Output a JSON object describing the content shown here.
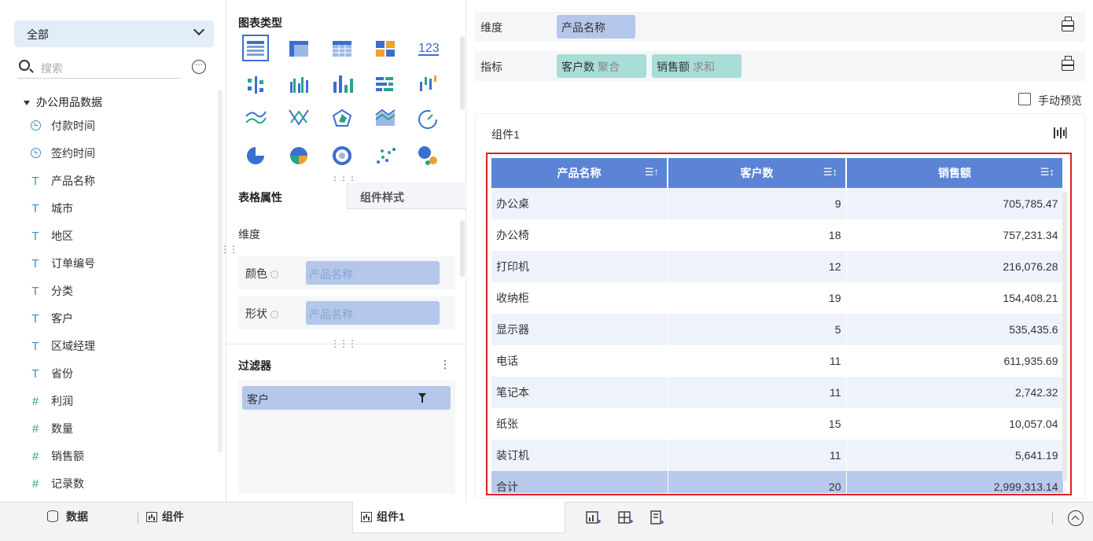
{
  "left": {
    "dropdown": "全部",
    "search_placeholder": "搜索",
    "more": "···",
    "dataset": "办公用品数据",
    "fields": [
      {
        "type": "date",
        "label": "付款时间"
      },
      {
        "type": "date",
        "label": "签约时间"
      },
      {
        "type": "text",
        "label": "产品名称"
      },
      {
        "type": "text",
        "label": "城市"
      },
      {
        "type": "text",
        "label": "地区"
      },
      {
        "type": "text",
        "label": "订单编号"
      },
      {
        "type": "text",
        "label": "分类"
      },
      {
        "type": "text",
        "label": "客户"
      },
      {
        "type": "text",
        "label": "区域经理"
      },
      {
        "type": "text",
        "label": "省份"
      },
      {
        "type": "number",
        "label": "利润"
      },
      {
        "type": "number",
        "label": "数量"
      },
      {
        "type": "number",
        "label": "销售额"
      },
      {
        "type": "number",
        "label": "记录数"
      }
    ]
  },
  "middle": {
    "chart_type_title": "图表类型",
    "tab_table_props": "表格属性",
    "tab_component_style": "组件样式",
    "dimension_label": "维度",
    "color_label": "颜色",
    "color_placeholder": "产品名称",
    "shape_label": "形状",
    "shape_placeholder": "产品名称",
    "filter_title": "过滤器",
    "filter_more": "⋮",
    "filter_item": "客户"
  },
  "right": {
    "dimension_label": "维度",
    "dimension_chip": "产品名称",
    "metric_label": "指标",
    "metric_chips": [
      {
        "name": "客户数",
        "agg": "聚合"
      },
      {
        "name": "销售额",
        "agg": "求和"
      }
    ],
    "manual_preview": "手动预览",
    "widget_title": "组件1",
    "table": {
      "headers": [
        "产品名称",
        "客户数",
        "销售额"
      ],
      "rows": [
        [
          "办公桌",
          "9",
          "705,785.47"
        ],
        [
          "办公椅",
          "18",
          "757,231.34"
        ],
        [
          "打印机",
          "12",
          "216,076.28"
        ],
        [
          "收纳柜",
          "19",
          "154,408.21"
        ],
        [
          "显示器",
          "5",
          "535,435.6"
        ],
        [
          "电话",
          "11",
          "611,935.69"
        ],
        [
          "笔记本",
          "11",
          "2,742.32"
        ],
        [
          "纸张",
          "15",
          "10,057.04"
        ],
        [
          "装订机",
          "11",
          "5,641.19"
        ]
      ],
      "total": [
        "合计",
        "20",
        "2,999,313.14"
      ]
    }
  },
  "bottom": {
    "data_tab": "数据",
    "component_tab": "组件",
    "active_tab": "组件1"
  },
  "colors": {
    "header_blue": "#5b83d6",
    "pill_blue": "#b4c7ea",
    "metric_green": "#a9ddd8",
    "highlight_red": "#e01e25"
  }
}
